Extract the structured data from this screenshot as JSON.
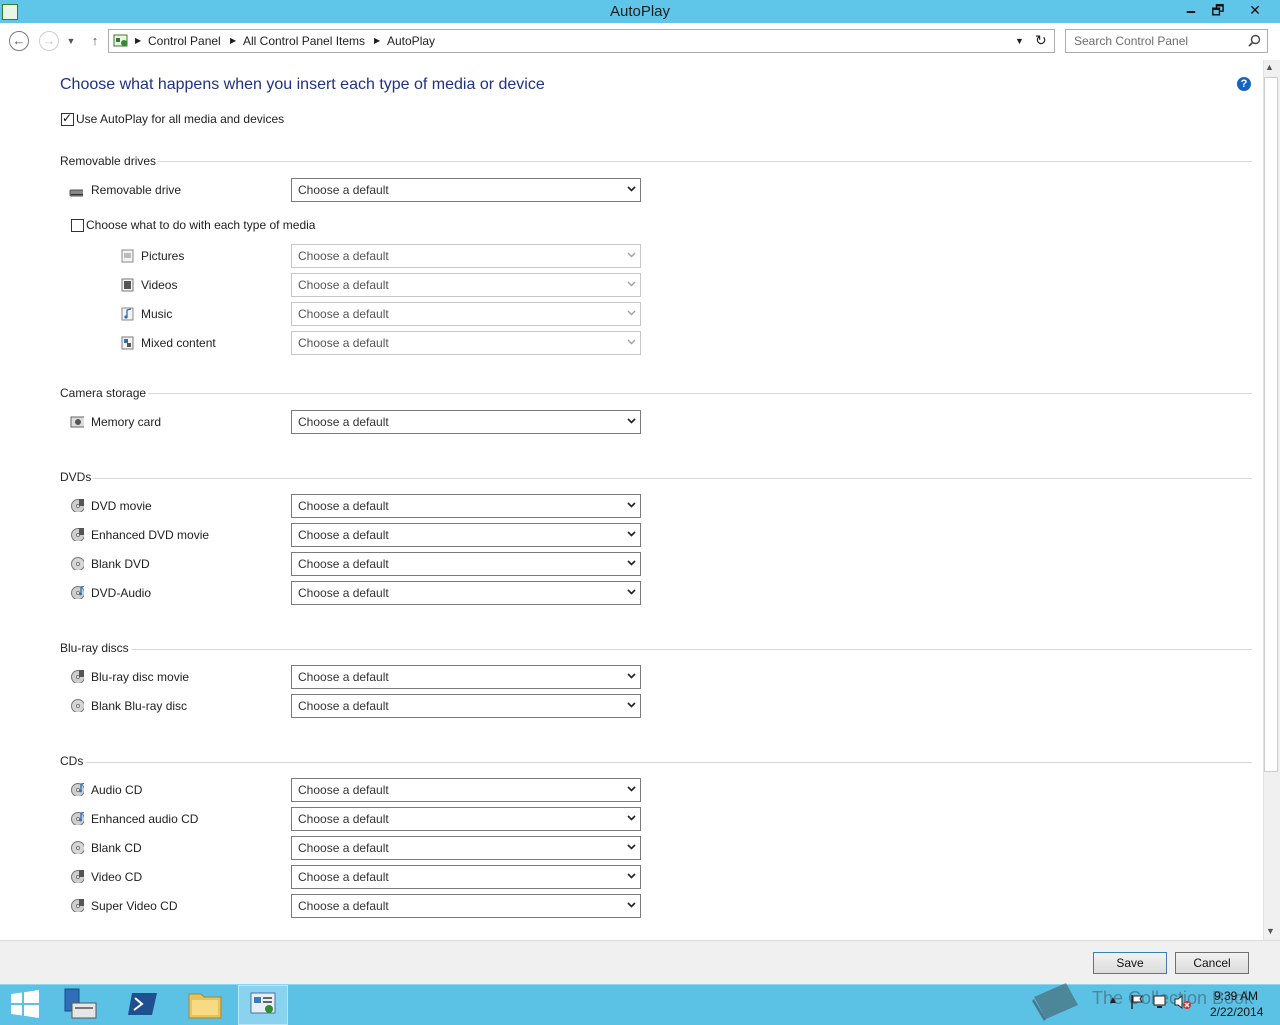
{
  "window": {
    "title": "AutoPlay"
  },
  "controls": {
    "minimize": "🗕",
    "restore": "🗗",
    "close": "✕"
  },
  "nav": {
    "breadcrumb": [
      "Control Panel",
      "All Control Panel Items",
      "AutoPlay"
    ],
    "search_placeholder": "Search Control Panel"
  },
  "main": {
    "heading": "Choose what happens when you insert each type of media or device",
    "use_autoplay_label": "Use AutoPlay for all media and devices",
    "use_autoplay_checked": true,
    "default_value": "Choose a default",
    "sections": {
      "removable": {
        "title": "Removable drives",
        "removable_drive": "Removable drive",
        "choose_each_label": "Choose what to do with each type of media",
        "choose_each_checked": false,
        "pictures": "Pictures",
        "videos": "Videos",
        "music": "Music",
        "mixed": "Mixed content"
      },
      "camera": {
        "title": "Camera storage",
        "memory_card": "Memory card"
      },
      "dvds": {
        "title": "DVDs",
        "dvd_movie": "DVD movie",
        "enhanced_dvd_movie": "Enhanced DVD movie",
        "blank_dvd": "Blank DVD",
        "dvd_audio": "DVD-Audio"
      },
      "bluray": {
        "title": "Blu-ray discs",
        "bluray_movie": "Blu-ray disc movie",
        "blank_bluray": "Blank Blu-ray disc"
      },
      "cds": {
        "title": "CDs",
        "audio_cd": "Audio CD",
        "enhanced_audio_cd": "Enhanced audio CD",
        "blank_cd": "Blank CD",
        "video_cd": "Video CD",
        "super_video_cd": "Super Video CD"
      }
    }
  },
  "footer": {
    "save": "Save",
    "cancel": "Cancel"
  },
  "taskbar": {
    "time": "9:39 AM",
    "date": "2/22/2014",
    "watermark": "The Collection Book"
  },
  "colors": {
    "titlebar": "#5fc6ea",
    "taskbar": "#5bc2e6",
    "heading": "#1e3287",
    "help": "#1565c0"
  }
}
